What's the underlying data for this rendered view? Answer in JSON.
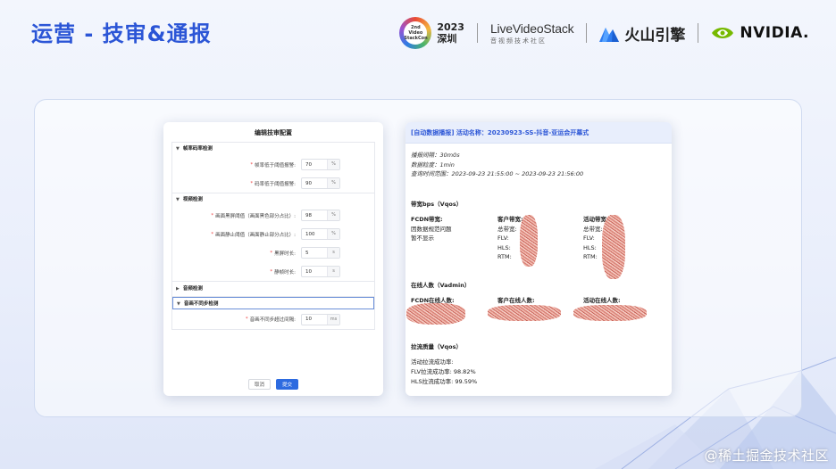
{
  "page": {
    "title": "运营 - 技审&通报"
  },
  "logos": {
    "conf_badge": "2023\n深圳",
    "conf_badge_inner": "2nd Video StackCon",
    "livevideostack": "LiveVideoStack",
    "livevideostack_sub": "音视频技术社区",
    "volcano": "火山引擎",
    "nvidia": "NVIDIA."
  },
  "dialog": {
    "title": "编辑技审配置",
    "sections": [
      {
        "label": "帧率码率检测",
        "expanded": true,
        "rows": [
          {
            "label": "帧率低于阈值报警:",
            "value": "70",
            "unit": "%"
          },
          {
            "label": "码率低于阈值报警:",
            "value": "90",
            "unit": "%"
          }
        ]
      },
      {
        "label": "视频检测",
        "expanded": true,
        "rows": [
          {
            "label": "画面黑屏阈值（画面黑色部分占比）:",
            "value": "98",
            "unit": "%"
          },
          {
            "label": "画面静止阈值（画面静止部分占比）:",
            "value": "100",
            "unit": "%"
          },
          {
            "label": "黑屏时长:",
            "value": "5",
            "unit": "s"
          },
          {
            "label": "静帧时长:",
            "value": "10",
            "unit": "s"
          }
        ]
      },
      {
        "label": "音频检测",
        "expanded": false,
        "rows": []
      },
      {
        "label": "音画不同步检测",
        "expanded": true,
        "active": true,
        "rows": [
          {
            "label": "音画不同步超过间隔:",
            "value": "10",
            "unit": "ms"
          }
        ]
      }
    ],
    "cancel_label": "取消",
    "submit_label": "提交"
  },
  "report": {
    "header": "[自动数据播报] 活动名称：20230923-SS-抖音-亚运会开幕式",
    "meta": [
      "播报间隔：30m0s",
      "数据粒度：1min",
      "查询时间范围：2023-09-23 21:55:00 ~ 2023-09-23 21:56:00"
    ],
    "bandwidth": {
      "title": "带宽bps（Vqos）",
      "fcdn": {
        "head": "FCDN带宽:",
        "lines": [
          "因数据规范问题",
          "暂不显示"
        ]
      },
      "customer": {
        "head": "客户带宽:",
        "lines": [
          "总带宽:",
          "FLV:",
          "HLS:",
          "RTM:"
        ]
      },
      "activity": {
        "head": "活动带宽:",
        "lines": [
          "总带宽:",
          "FLV:",
          "HLS:",
          "RTM:"
        ]
      }
    },
    "online": {
      "title": "在线人数（Vadmin）",
      "fcdn": "FCDN在线人数:",
      "customer": "客户在线人数:",
      "activity": "活动在线人数:"
    },
    "pull": {
      "title": "拉流质量（Vqos）",
      "lines": [
        "活动拉流成功率:",
        "FLV拉流成功率:  98.82%",
        "HLS拉流成功率:  99.59%"
      ]
    }
  },
  "watermark": "@稀土掘金技术社区",
  "colors": {
    "accent": "#2b55d6",
    "submit": "#2d6be0"
  }
}
